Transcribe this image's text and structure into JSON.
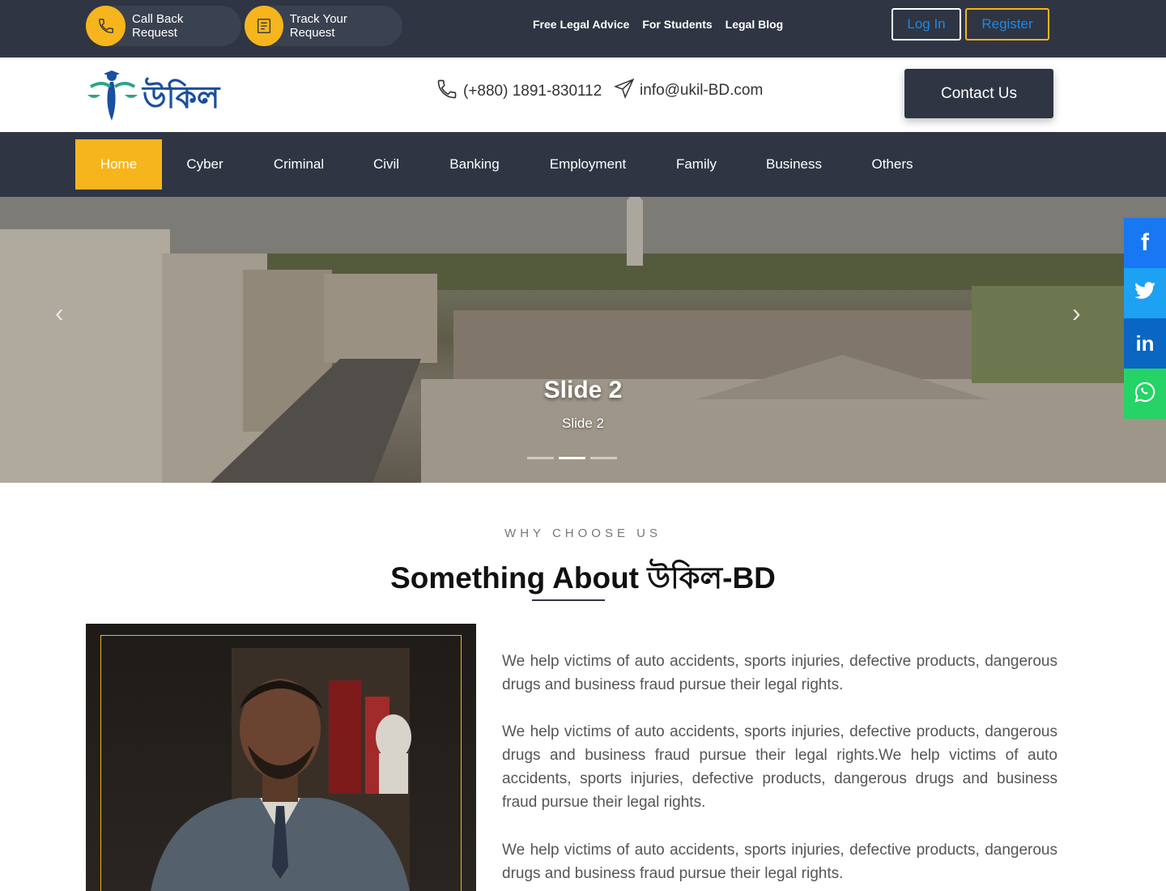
{
  "topbar": {
    "call_back": "Call Back Request",
    "track": "Track Your Request",
    "links": [
      "Free Legal Advice",
      "For Students",
      "Legal Blog"
    ],
    "login": "Log In",
    "register": "Register"
  },
  "header": {
    "logo_text": "উকিল",
    "phone": "(+880) 1891-830112",
    "email": "info@ukil-BD.com",
    "contact_button": "Contact Us"
  },
  "nav": [
    "Home",
    "Cyber",
    "Criminal",
    "Civil",
    "Banking",
    "Employment",
    "Family",
    "Business",
    "Others"
  ],
  "hero": {
    "title": "Slide 2",
    "subtitle": "Slide 2",
    "slides_total": 3,
    "active_slide": 2
  },
  "social": [
    "facebook",
    "twitter",
    "linkedin",
    "whatsapp"
  ],
  "about": {
    "eyebrow": "WHY CHOOSE US",
    "title": "Something About উকিল-BD",
    "paragraphs": [
      "We help victims of auto accidents, sports injuries, defective products, dangerous drugs and business fraud pursue their legal rights.",
      "We help victims of auto accidents, sports injuries, defective products, dangerous drugs and business fraud pursue their legal rights.We help victims of auto accidents, sports injuries, defective products, dangerous drugs and business fraud pursue their legal rights.",
      "We help victims of auto accidents, sports injuries, defective products, dangerous drugs and business fraud pursue their legal rights."
    ]
  },
  "colors": {
    "dark": "#2f3543",
    "accent": "#f6b51c",
    "login_blue": "#1e88e5",
    "facebook": "#1877f2",
    "twitter": "#1da1f2",
    "linkedin": "#0a66c2",
    "whatsapp": "#25d366"
  }
}
